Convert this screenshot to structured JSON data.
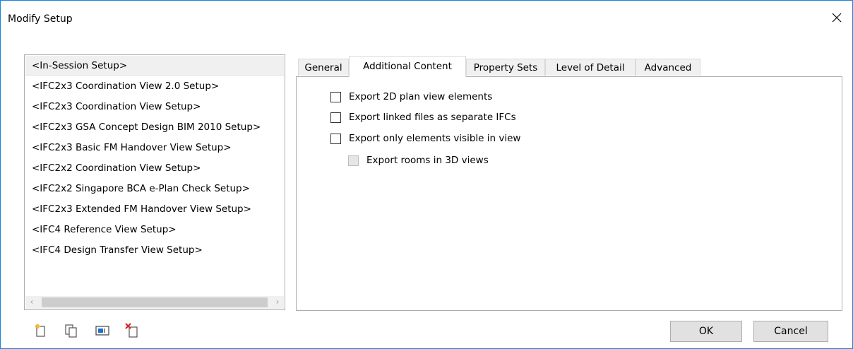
{
  "window": {
    "title": "Modify Setup",
    "accent_color": "#1883d7"
  },
  "setups": [
    {
      "label": "<In-Session Setup>",
      "selected": true
    },
    {
      "label": "<IFC2x3 Coordination View 2.0 Setup>",
      "selected": false
    },
    {
      "label": "<IFC2x3 Coordination View Setup>",
      "selected": false
    },
    {
      "label": "<IFC2x3 GSA Concept Design BIM 2010 Setup>",
      "selected": false
    },
    {
      "label": "<IFC2x3 Basic FM Handover View Setup>",
      "selected": false
    },
    {
      "label": "<IFC2x2 Coordination View Setup>",
      "selected": false
    },
    {
      "label": "<IFC2x2 Singapore BCA e-Plan Check Setup>",
      "selected": false
    },
    {
      "label": "<IFC2x3 Extended FM Handover View Setup>",
      "selected": false
    },
    {
      "label": "<IFC4 Reference View Setup>",
      "selected": false
    },
    {
      "label": "<IFC4 Design Transfer View Setup>",
      "selected": false
    }
  ],
  "tabs": [
    {
      "label": "General",
      "active": false
    },
    {
      "label": "Additional Content",
      "active": true
    },
    {
      "label": "Property Sets",
      "active": false
    },
    {
      "label": "Level of Detail",
      "active": false
    },
    {
      "label": "Advanced",
      "active": false
    }
  ],
  "additional_content": {
    "options": [
      {
        "label": "Export 2D plan view elements",
        "checked": false,
        "enabled": true
      },
      {
        "label": "Export linked files as separate IFCs",
        "checked": false,
        "enabled": true
      },
      {
        "label": "Export only elements visible in view",
        "checked": false,
        "enabled": true
      },
      {
        "label": "Export rooms in 3D views",
        "checked": false,
        "enabled": false
      }
    ]
  },
  "toolbar": {
    "icons": [
      "new-setup-icon",
      "duplicate-setup-icon",
      "rename-setup-icon",
      "delete-setup-icon"
    ]
  },
  "buttons": {
    "ok": "OK",
    "cancel": "Cancel"
  }
}
